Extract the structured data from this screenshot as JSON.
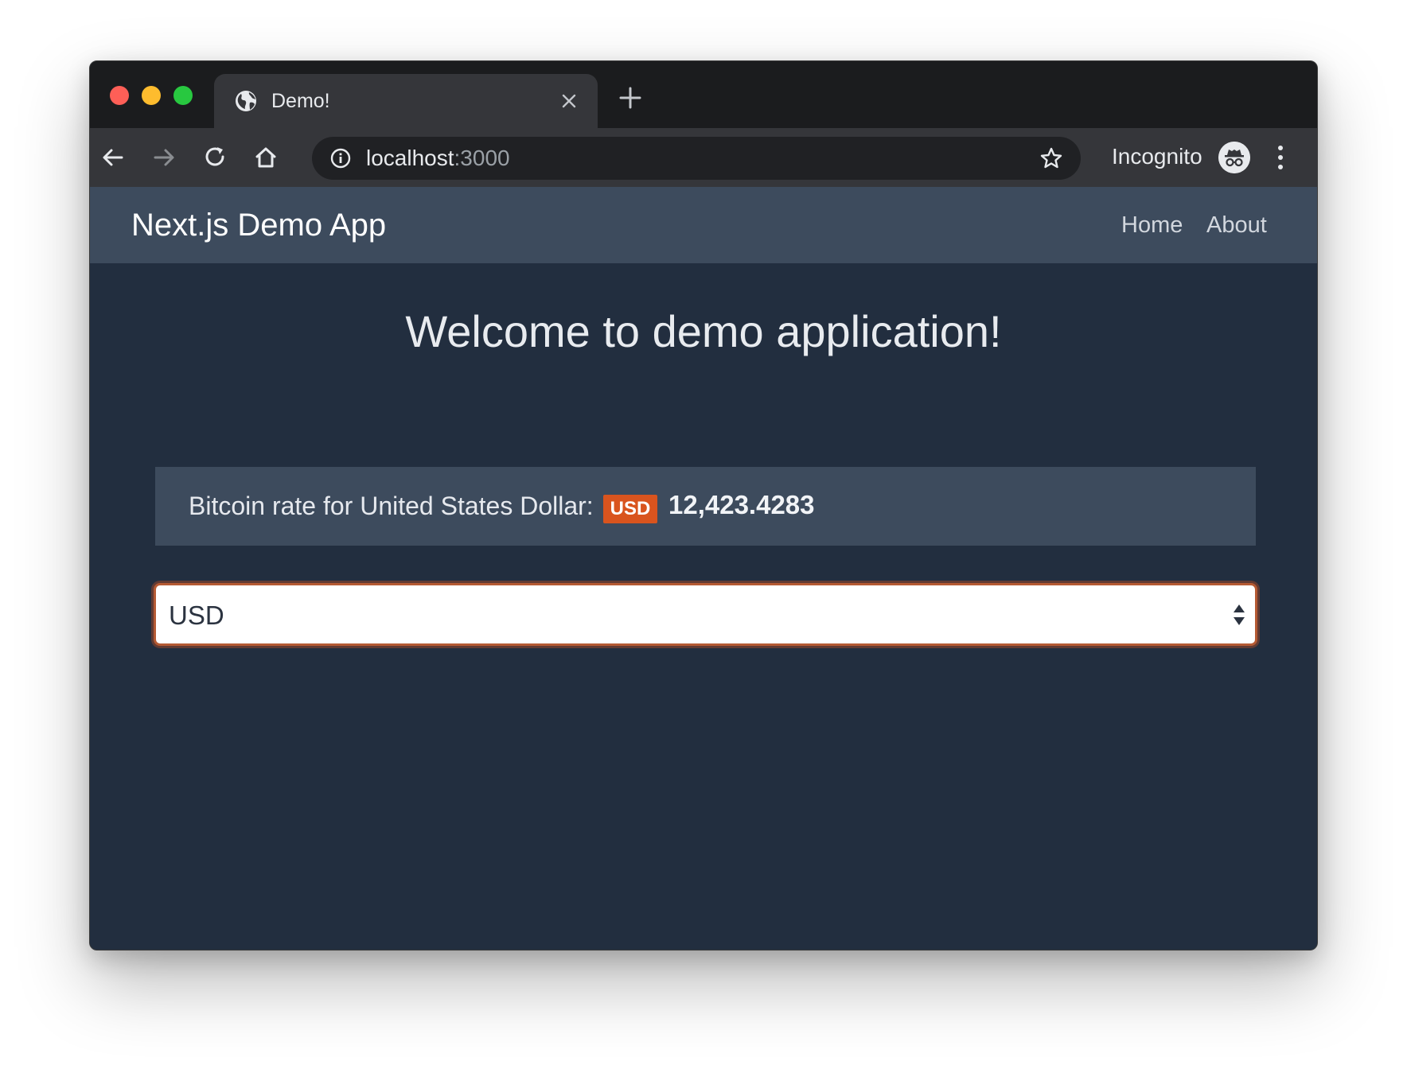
{
  "browser": {
    "tab": {
      "title": "Demo!",
      "icon": "globe-icon"
    },
    "toolbar": {
      "url_host": "localhost",
      "url_port": ":3000",
      "profile_label": "Incognito"
    }
  },
  "app": {
    "navbar": {
      "brand": "Next.js Demo App",
      "links": [
        {
          "label": "Home"
        },
        {
          "label": "About"
        }
      ]
    },
    "heading": "Welcome to demo application!",
    "rate": {
      "label": "Bitcoin rate for United States Dollar:",
      "currency_code": "USD",
      "value": "12,423.4283",
      "badge_color": "#d9541e"
    },
    "currency_select": {
      "selected": "USD"
    }
  }
}
